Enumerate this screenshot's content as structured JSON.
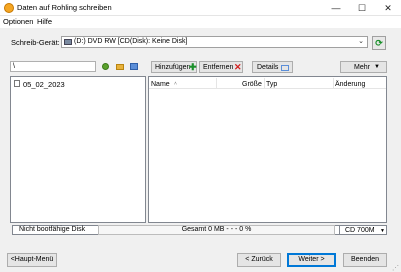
{
  "window": {
    "title": "Daten auf Rohling schreiben",
    "minimize": "—",
    "maximize": "☐",
    "close": "✕"
  },
  "menu": [
    "Optionen",
    "Hilfe"
  ],
  "recorder": {
    "label": "Schreib-Gerät:",
    "selected": "(D:) DVD RW [CD(Disk): Keine Disk]"
  },
  "path": {
    "value": "\\"
  },
  "toolbar": {
    "add": "Hinzufügen",
    "remove": "Entfernen",
    "details": "Details",
    "more": "Mehr"
  },
  "tree": {
    "items": [
      "05_02_2023"
    ]
  },
  "columns": {
    "name": "Name",
    "size": "Größe",
    "type": "Typ",
    "changed": "Änderung"
  },
  "status": {
    "boot": "Nicht bootfähige Disk",
    "total": "Gesamt 0 MB - - - 0 %",
    "media": "CD 700M"
  },
  "nav": {
    "main_menu": "<Haupt-Menü",
    "back": "< Zurück",
    "next": "Weiter >",
    "quit": "Beenden"
  },
  "colors": {
    "accent": "#0078d7",
    "refresh": "#1a8f2a"
  }
}
